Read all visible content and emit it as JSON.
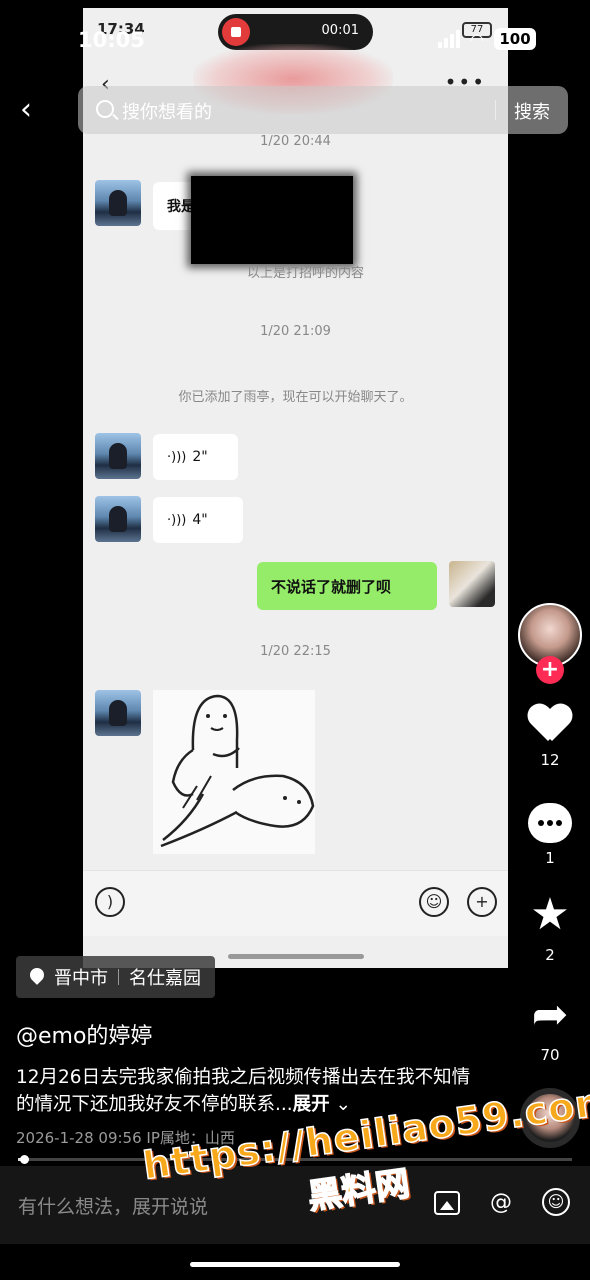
{
  "status_bar": {
    "time": "10:05",
    "battery": "100"
  },
  "search": {
    "placeholder": "搜你想看的",
    "button": "搜索"
  },
  "video": {
    "inner_status": {
      "time": "17:34",
      "record_time": "00:01",
      "battery": "77"
    },
    "chat": {
      "timestamps": [
        "1/20 20:44",
        "1/20 21:09",
        "1/20 22:15"
      ],
      "greeting_prefix": "我是",
      "greeting_note": "以上是打招呼的内容",
      "system_added": "你已添加了雨亭，现在可以开始聊天了。",
      "voice_messages": [
        "2\"",
        "4\""
      ],
      "my_message": "不说话了就删了呗"
    }
  },
  "rail": {
    "likes": "12",
    "comments": "1",
    "favorites": "2",
    "shares": "70"
  },
  "location": {
    "city": "晋中市",
    "place": "名仕嘉园"
  },
  "author": "@emo的婷婷",
  "description": "12月26日去完我家偷拍我之后视频传播出去在我不知情的情况下还加我好友不停的联系...",
  "expand": "展开",
  "meta": "2026-1-28 09:56  IP属地：山西",
  "progress": 0.01,
  "comment_bar": {
    "placeholder": "有什么想法，展开说说"
  },
  "watermark": {
    "url": "https://heiliao59.com",
    "name": "黑料网"
  },
  "colors": {
    "accent": "#fe2c55",
    "chat_green": "#95ec69",
    "watermark": "#f7a81b"
  }
}
